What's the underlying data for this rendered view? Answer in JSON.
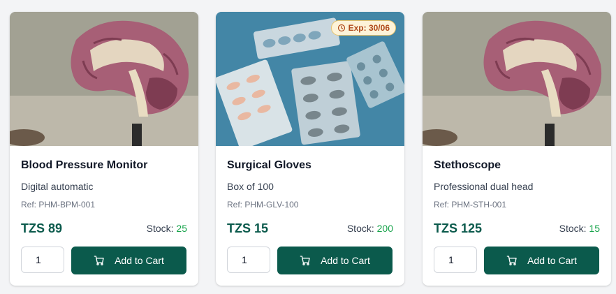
{
  "products": [
    {
      "name": "Blood Pressure Monitor",
      "description": "Digital automatic",
      "ref": "Ref: PHM-BPM-001",
      "price": "TZS 89",
      "stock_label": "Stock:",
      "stock_value": "25",
      "quantity": "1",
      "button_label": "Add to Cart",
      "image": "brain-anatomy-model"
    },
    {
      "name": "Surgical Gloves",
      "description": "Box of 100",
      "ref": "Ref: PHM-GLV-100",
      "price": "TZS 15",
      "stock_label": "Stock:",
      "stock_value": "200",
      "quantity": "1",
      "button_label": "Add to Cart",
      "image": "pill-blister-packs",
      "badge": "Exp: 30/06"
    },
    {
      "name": "Stethoscope",
      "description": "Professional dual head",
      "ref": "Ref: PHM-STH-001",
      "price": "TZS 125",
      "stock_label": "Stock:",
      "stock_value": "15",
      "quantity": "1",
      "button_label": "Add to Cart",
      "image": "brain-anatomy-model"
    }
  ],
  "colors": {
    "primary": "#0b5a4c",
    "stock_green": "#16a34a",
    "badge_bg": "#fdf3d8",
    "badge_text": "#b04a1b",
    "page_bg": "#f3f4f6"
  },
  "icons": {
    "cart": "cart-icon",
    "clock": "clock-icon"
  }
}
